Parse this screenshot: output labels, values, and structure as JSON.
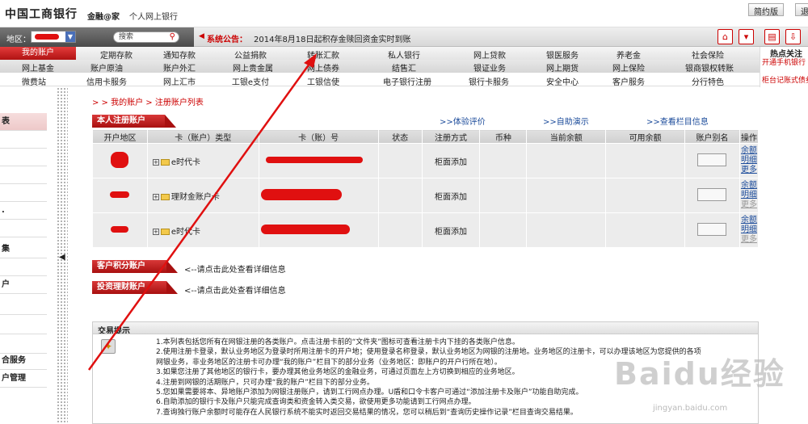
{
  "header": {
    "logo": "中国工商银行",
    "brand": "金融@家",
    "subtitle": "个人网上银行",
    "btn_simple": "简约版",
    "btn_exit": "退"
  },
  "region": {
    "label": "地区："
  },
  "search": {
    "placeholder": "搜索"
  },
  "announcement": {
    "label": "系统公告：",
    "text": "2014年8月18日起积存金赎回资金实时到账"
  },
  "nav": {
    "row1": [
      "我的账户",
      "定期存款",
      "通知存款",
      "公益捐款",
      "转账汇款",
      "私人银行",
      "网上贷款",
      "银医服务",
      "养老金",
      "社会保险"
    ],
    "row2": [
      "网上基金",
      "账户原油",
      "账户外汇",
      "网上贵金属",
      "网上债券",
      "结售汇",
      "银证业务",
      "网上期货",
      "网上保险",
      "银商银权转账"
    ],
    "row3": [
      "微费站",
      "信用卡服务",
      "网上汇市",
      "工银e支付",
      "工银信使",
      "电子银行注册",
      "银行卡服务",
      "安全中心",
      "客户服务",
      "分行特色"
    ]
  },
  "hot": {
    "title": "热点关注",
    "item1": "开通手机银行",
    "item2": "柜台记账式债券"
  },
  "sidebar": [
    "表",
    "",
    "",
    "",
    "",
    ".",
    "",
    "集",
    "",
    "",
    "户",
    "",
    "",
    "",
    "合服务",
    "户管理"
  ],
  "breadcrumb": "> > 我的账户 > 注册账户列表",
  "section_accounts": {
    "title": "本人注册账户",
    "link1": ">>体验评价",
    "link2": ">>自助演示",
    "link3": ">>查看栏目信息"
  },
  "table": {
    "headers": [
      "开户地区",
      "卡（账户）类型",
      "卡（账）号",
      "状态",
      "注册方式",
      "币种",
      "当前余额",
      "可用余额",
      "账户别名",
      "操作"
    ],
    "rows": [
      {
        "type": "e时代卡",
        "method": "柜面添加",
        "ops": [
          "余额",
          "明细",
          "更多"
        ]
      },
      {
        "type": "理财金账户卡",
        "method": "柜面添加",
        "ops": [
          "余额",
          "明细",
          "更多"
        ]
      },
      {
        "type": "e时代卡",
        "method": "柜面添加",
        "ops": [
          "余额",
          "明细",
          "更多"
        ]
      }
    ]
  },
  "section_points": {
    "title": "客户积分账户",
    "hint": "<--请点击此处查看详细信息"
  },
  "section_invest": {
    "title": "投资理财账户",
    "hint": "<--请点击此处查看详细信息"
  },
  "tips_section": {
    "title": "交易提示",
    "lines": [
      "1.本列表包括您所有在网银注册的各类账户。点击注册卡前的“文件夹”图标可查看注册卡内下挂的各类账户信息。",
      "2.使用注册卡登录，默认业务地区为登录时所用注册卡的开户地；使用登录名称登录，默认业务地区为网银的注册地。业务地区的注册卡，可以办理该地区为您提供的各项",
      "网银业务，非业务地区的注册卡可办理“我的账户”栏目下的部分业务（业务地区：即账户的开户行所在地）。",
      "3.如果您注册了其他地区的银行卡，要办理其他业务地区的金融业务，可通过页面左上方切换到相应的业务地区。",
      "4.注册到网银的活期账户，只可办理“我的账户”栏目下的部分业务。",
      "5.您如果需要将本、异地账户添加为网银注册账户，请到工行网点办理。U盾和口令卡客户可通过“添加注册卡及账户”功能自助完成。",
      "6.自助添加的银行卡及账户只能完成查询类和资金转入类交易，欲使用更多功能请到工行网点办理。",
      "7.查询独行账户余额时可能存在人民银行系统不能实时返回交易结果的情况，您可以稍后到“查询历史操作记录”栏目查询交易结果。"
    ]
  },
  "watermark": {
    "main": "Baidu经验",
    "url": "jingyan.baidu.com"
  },
  "colors": {
    "accent": "#c40000",
    "link": "#1a4a9a"
  }
}
